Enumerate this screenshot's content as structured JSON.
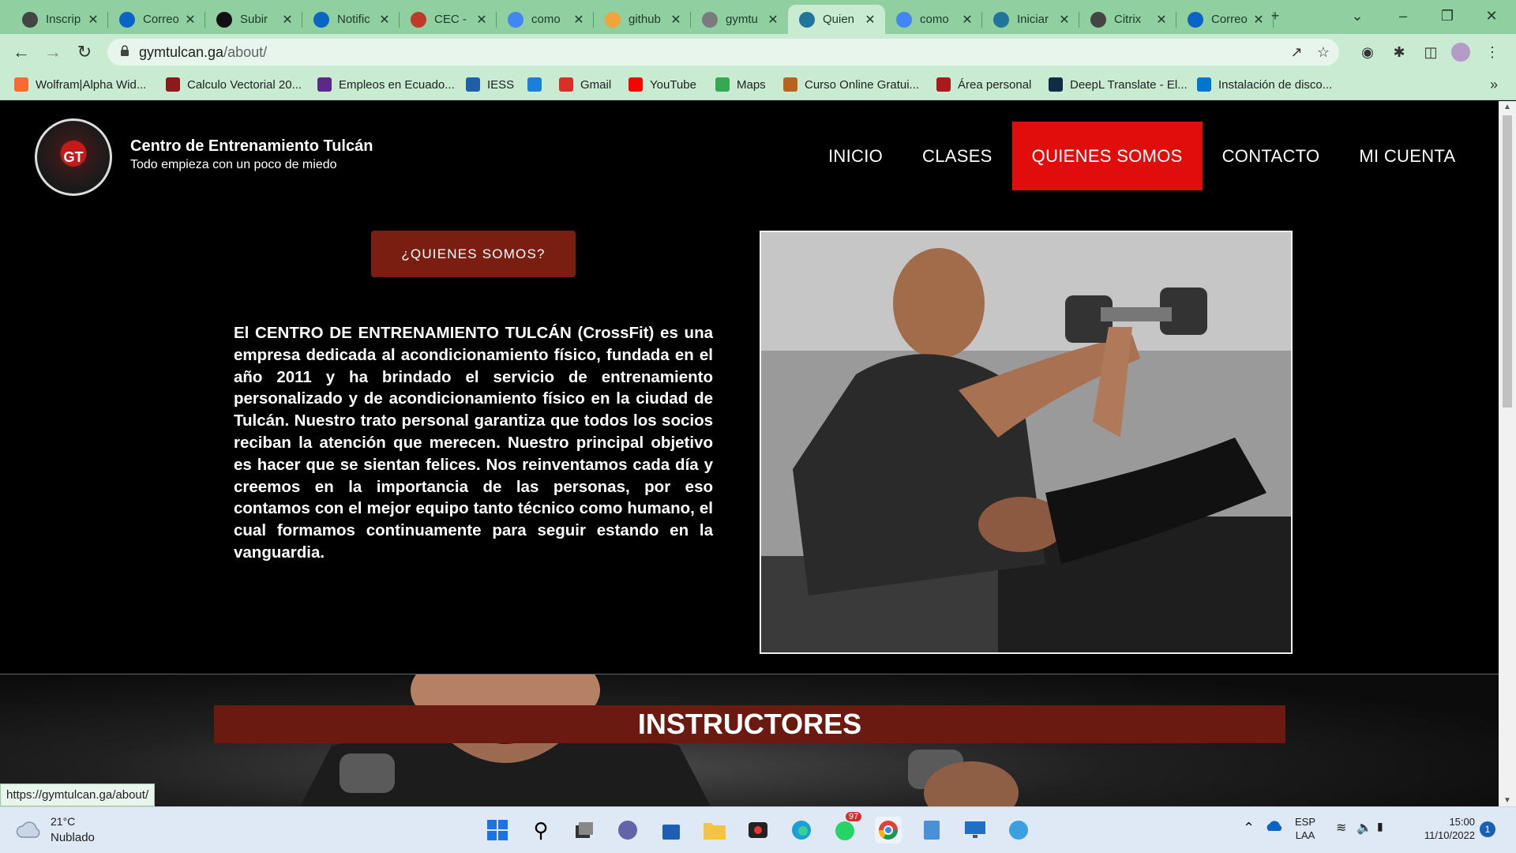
{
  "browser": {
    "tabs": [
      {
        "label": "Inscrip",
        "icon": "globe-icon",
        "color": "#444444"
      },
      {
        "label": "Correo",
        "icon": "outlook-icon",
        "color": "#0a64c8"
      },
      {
        "label": "Subir",
        "icon": "github-icon",
        "color": "#111111"
      },
      {
        "label": "Notific",
        "icon": "linkedin-icon",
        "color": "#0a66c2"
      },
      {
        "label": "CEC -",
        "icon": "cec-icon",
        "color": "#c0392b"
      },
      {
        "label": "como",
        "icon": "google-icon",
        "color": "#4285f4"
      },
      {
        "label": "github",
        "icon": "stackoverflow-icon",
        "color": "#f2a33a"
      },
      {
        "label": "gymtu",
        "icon": "globe-icon",
        "color": "#7b7b7b"
      },
      {
        "label": "Quien",
        "icon": "wordpress-icon",
        "color": "#21759b"
      },
      {
        "label": "como",
        "icon": "google-icon",
        "color": "#4285f4"
      },
      {
        "label": "Iniciar",
        "icon": "wordpress-icon",
        "color": "#21759b"
      },
      {
        "label": "Citrix",
        "icon": "citrix-icon",
        "color": "#444444"
      },
      {
        "label": "Correo",
        "icon": "outlook-icon",
        "color": "#0a64c8"
      }
    ],
    "active_tab_index": 8,
    "new_tab_label": "+",
    "url_host": "gymtulcan.ga",
    "url_path": "/about/",
    "bookmarks": [
      {
        "label": "Wolfram|Alpha Wid...",
        "icon": "wolfram-icon",
        "color": "#f96932"
      },
      {
        "label": "Calculo Vectorial 20...",
        "icon": "book-icon",
        "color": "#8b1a1a"
      },
      {
        "label": "Empleos en Ecuado...",
        "icon": "chevron-icon",
        "color": "#5b2a86"
      },
      {
        "label": "IESS",
        "icon": "iess-icon",
        "color": "#1f5fa8"
      },
      {
        "label": "",
        "icon": "appstore-icon",
        "color": "#1a7fd8"
      },
      {
        "label": "Gmail",
        "icon": "gmail-icon",
        "color": "#d93025"
      },
      {
        "label": "YouTube",
        "icon": "youtube-icon",
        "color": "#ff0000"
      },
      {
        "label": "Maps",
        "icon": "maps-icon",
        "color": "#34a853"
      },
      {
        "label": "Curso Online Gratui...",
        "icon": "course-icon",
        "color": "#b5651d"
      },
      {
        "label": "Área personal",
        "icon": "moodle-icon",
        "color": "#a61b1b"
      },
      {
        "label": "DeepL Translate - El...",
        "icon": "deepl-icon",
        "color": "#0f2b46"
      },
      {
        "label": "Instalación de disco...",
        "icon": "dell-icon",
        "color": "#0076ce"
      }
    ]
  },
  "site": {
    "logo_text": "GT",
    "title": "Centro de Entrenamiento Tulcán",
    "tagline": "Todo empieza con un poco de miedo",
    "nav": [
      "INICIO",
      "CLASES",
      "QUIENES SOMOS",
      "CONTACTO",
      "MI CUENTA"
    ],
    "active_nav_index": 2,
    "nav_active_color": "#e10d0d",
    "about_button": "¿QUIENES SOMOS?",
    "about_text": "El CENTRO DE ENTRENAMIENTO TULCÁN (CrossFit) es una empresa dedicada al acondicionamiento físico, fundada en el año 2011 y ha brindado el servicio de entrenamiento personalizado y de acondicionamiento físico en la ciudad de Tulcán. Nuestro trato personal garantiza que todos los socios reciban la atención que merecen. Nuestro principal objetivo es hacer que se sientan felices. Nos reinventamos cada día y creemos en la importancia de las personas, por eso contamos con el mejor equipo tanto técnico como humano, el cual formamos continuamente para seguir estando en la vanguardia.",
    "instructors_heading": "INSTRUCTORES",
    "accent_color": "#7a1e12"
  },
  "status_url": "https://gymtulcan.ga/about/",
  "taskbar": {
    "temperature": "21°C",
    "weather": "Nublado",
    "language_1": "ESP",
    "language_2": "LAA",
    "time": "15:00",
    "date": "11/10/2022",
    "notification_count": "1",
    "whatsapp_badge": "97"
  }
}
